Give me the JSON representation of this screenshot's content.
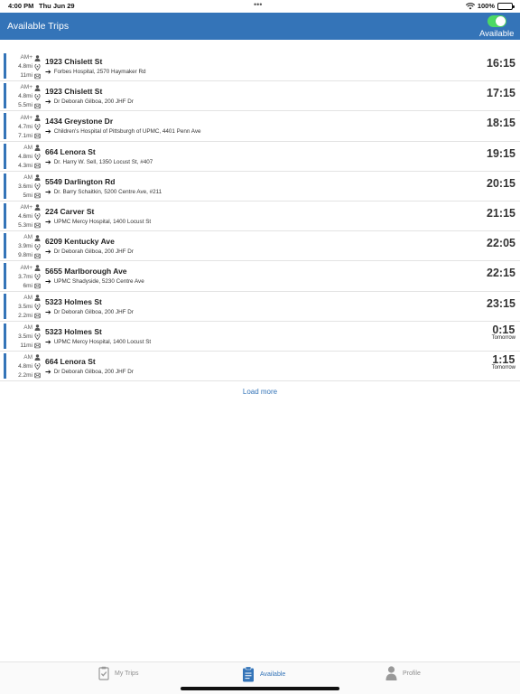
{
  "status_bar": {
    "time": "4:00 PM",
    "date": "Thu Jun 29",
    "dots": "•••",
    "battery": "100%"
  },
  "header": {
    "title": "Available Trips",
    "toggle_label": "Available",
    "toggle_on": true,
    "accent": "#3474b8",
    "toggle_color": "#4cd964"
  },
  "trips": [
    {
      "ampm": "AM+",
      "dist1": "4.8mi",
      "dist2": "11mi",
      "address": "1923 Chislett St",
      "destination": "Forbes Hospital, 2570 Haymaker Rd",
      "time": "16:15",
      "day": ""
    },
    {
      "ampm": "AM+",
      "dist1": "4.8mi",
      "dist2": "5.5mi",
      "address": "1923 Chislett St",
      "destination": "Dr Deborah Gilboa, 200 JHF Dr",
      "time": "17:15",
      "day": ""
    },
    {
      "ampm": "AM+",
      "dist1": "4.7mi",
      "dist2": "7.1mi",
      "address": "1434 Greystone Dr",
      "destination": "Children's Hospital of Pittsburgh of UPMC, 4401 Penn Ave",
      "time": "18:15",
      "day": ""
    },
    {
      "ampm": "AM",
      "dist1": "4.8mi",
      "dist2": "4.3mi",
      "address": "664 Lenora St",
      "destination": "Dr. Harry W. Sell, 1350 Locust St, #407",
      "time": "19:15",
      "day": ""
    },
    {
      "ampm": "AM",
      "dist1": "3.6mi",
      "dist2": "5mi",
      "address": "5549 Darlington Rd",
      "destination": "Dr. Barry Schaitkin, 5200 Centre Ave, #211",
      "time": "20:15",
      "day": ""
    },
    {
      "ampm": "AM+",
      "dist1": "4.6mi",
      "dist2": "5.3mi",
      "address": "224 Carver St",
      "destination": "UPMC Mercy Hospital, 1400 Locust St",
      "time": "21:15",
      "day": ""
    },
    {
      "ampm": "AM",
      "dist1": "3.9mi",
      "dist2": "9.8mi",
      "address": "6209 Kentucky Ave",
      "destination": "Dr Deborah Gilboa, 200 JHF Dr",
      "time": "22:05",
      "day": ""
    },
    {
      "ampm": "AM+",
      "dist1": "3.7mi",
      "dist2": "6mi",
      "address": "5655 Marlborough Ave",
      "destination": "UPMC Shadyside, 5230 Centre Ave",
      "time": "22:15",
      "day": ""
    },
    {
      "ampm": "AM",
      "dist1": "3.5mi",
      "dist2": "2.2mi",
      "address": "5323 Holmes St",
      "destination": "Dr Deborah Gilboa, 200 JHF Dr",
      "time": "23:15",
      "day": ""
    },
    {
      "ampm": "AM",
      "dist1": "3.5mi",
      "dist2": "11mi",
      "address": "5323 Holmes St",
      "destination": "UPMC Mercy Hospital, 1400 Locust St",
      "time": "0:15",
      "day": "Tomorrow"
    },
    {
      "ampm": "AM",
      "dist1": "4.8mi",
      "dist2": "2.2mi",
      "address": "664 Lenora St",
      "destination": "Dr Deborah Gilboa, 200 JHF Dr",
      "time": "1:15",
      "day": "Tomorrow"
    }
  ],
  "load_more": "Load more",
  "tabs": [
    {
      "label": "My Trips",
      "icon": "clipboard-check-icon",
      "active": false
    },
    {
      "label": "Available",
      "icon": "clipboard-list-icon",
      "active": true
    },
    {
      "label": "Profile",
      "icon": "person-icon",
      "active": false
    }
  ]
}
